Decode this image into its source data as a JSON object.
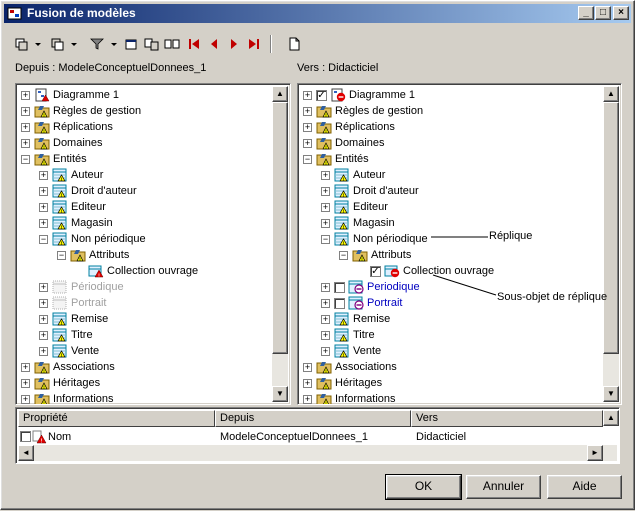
{
  "window": {
    "title": "Fusion de modèles"
  },
  "left_pane": {
    "label": "Depuis : ModeleConceptuelDonnees_1",
    "items": [
      {
        "label": "Diagramme 1"
      },
      {
        "label": "Règles de gestion"
      },
      {
        "label": "Réplications"
      },
      {
        "label": "Domaines"
      },
      {
        "label": "Entités"
      },
      {
        "label": "Auteur"
      },
      {
        "label": "Droit d'auteur"
      },
      {
        "label": "Editeur"
      },
      {
        "label": "Magasin"
      },
      {
        "label": "Non périodique"
      },
      {
        "label": "Attributs"
      },
      {
        "label": "Collection ouvrage"
      },
      {
        "label": "Périodique"
      },
      {
        "label": "Portrait"
      },
      {
        "label": "Remise"
      },
      {
        "label": "Titre"
      },
      {
        "label": "Vente"
      },
      {
        "label": "Associations"
      },
      {
        "label": "Héritages"
      },
      {
        "label": "Informations"
      }
    ]
  },
  "right_pane": {
    "label": "Vers : Didacticiel",
    "items": [
      {
        "label": "Diagramme 1"
      },
      {
        "label": "Règles de gestion"
      },
      {
        "label": "Réplications"
      },
      {
        "label": "Domaines"
      },
      {
        "label": "Entités"
      },
      {
        "label": "Auteur"
      },
      {
        "label": "Droit d'auteur"
      },
      {
        "label": "Editeur"
      },
      {
        "label": "Magasin"
      },
      {
        "label": "Non périodique"
      },
      {
        "label": "Attributs"
      },
      {
        "label": "Collection ouvrage"
      },
      {
        "label": "Periodique"
      },
      {
        "label": "Portrait"
      },
      {
        "label": "Remise"
      },
      {
        "label": "Titre"
      },
      {
        "label": "Vente"
      },
      {
        "label": "Associations"
      },
      {
        "label": "Héritages"
      },
      {
        "label": "Informations"
      }
    ]
  },
  "annotations": {
    "replique": "Réplique",
    "sous_objet": "Sous-objet de réplique"
  },
  "grid": {
    "columns": [
      "Propriété",
      "Depuis",
      "Vers"
    ],
    "rows": [
      {
        "propriete": "Nom",
        "depuis": "ModeleConceptuelDonnees_1",
        "vers": "Didacticiel"
      }
    ]
  },
  "buttons": {
    "ok": "OK",
    "cancel": "Annuler",
    "help": "Aide"
  },
  "colors": {
    "title_start": "#0a246a",
    "title_end": "#a6caf0",
    "nav_arrow": "#c00000",
    "link_blue": "#0000c0"
  }
}
